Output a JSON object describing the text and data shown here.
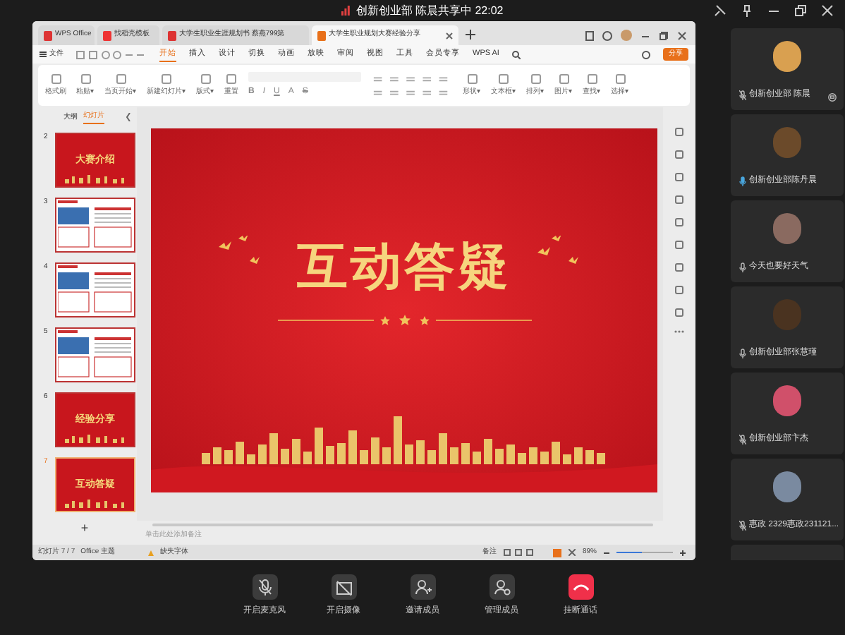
{
  "top_bar": {
    "title": "创新创业部 陈晨共享中 22:02"
  },
  "wps": {
    "tabs": [
      {
        "label": "WPS Office",
        "selected": false,
        "kind": "home"
      },
      {
        "label": "找稻壳模板",
        "selected": false,
        "kind": "template"
      },
      {
        "label": "大学生职业生涯规划书 蔡燕799第",
        "selected": false,
        "kind": "doc"
      },
      {
        "label": "大学生职业规划大赛经验分享",
        "selected": true,
        "kind": "doc"
      }
    ],
    "menu": {
      "file": "文件",
      "items": [
        {
          "label": "开始",
          "selected": true
        },
        {
          "label": "插入",
          "selected": false
        },
        {
          "label": "设计",
          "selected": false
        },
        {
          "label": "切换",
          "selected": false
        },
        {
          "label": "动画",
          "selected": false
        },
        {
          "label": "放映",
          "selected": false
        },
        {
          "label": "审阅",
          "selected": false
        },
        {
          "label": "视图",
          "selected": false
        },
        {
          "label": "工具",
          "selected": false
        },
        {
          "label": "会员专享",
          "selected": false
        },
        {
          "label": "WPS AI",
          "selected": false
        }
      ],
      "share": "分享"
    },
    "ribbon": {
      "left": [
        "格式刷",
        "粘贴▾",
        "当页开始▾",
        "新建幻灯片▾",
        "版式▾",
        "重置"
      ],
      "font_buttons": [
        "B",
        "I",
        "U",
        "A",
        "S"
      ],
      "right": [
        "形状▾",
        "文本框▾",
        "排列▾",
        "图片▾",
        "查找▾",
        "选择▾"
      ]
    },
    "panel_tabs": [
      {
        "label": "大纲",
        "selected": false
      },
      {
        "label": "幻灯片",
        "selected": true
      }
    ],
    "thumbnails": [
      {
        "number": "2",
        "kind": "title",
        "title": "大赛介绍",
        "selected": false
      },
      {
        "number": "3",
        "kind": "content",
        "selected": false
      },
      {
        "number": "4",
        "kind": "content",
        "selected": false
      },
      {
        "number": "5",
        "kind": "content",
        "selected": false
      },
      {
        "number": "6",
        "kind": "title",
        "title": "经验分享",
        "selected": false
      },
      {
        "number": "7",
        "kind": "title",
        "title": "互动答疑",
        "selected": true
      }
    ],
    "add_slide": "+",
    "slide": {
      "title": "互动答疑"
    },
    "notes_placeholder": "单击此处添加备注",
    "status": {
      "slide_count": "幻灯片 7 / 7",
      "theme": "Office 主题",
      "missing_font": "缺失字体",
      "notes": "备注",
      "zoom": "89%",
      "zoom_slider": {
        "level": 0.45
      }
    }
  },
  "participants": [
    {
      "name": "创新创业部 陈晨",
      "muted": true,
      "speaking": false,
      "sharing": true
    },
    {
      "name": "创新创业部陈丹晨",
      "muted": false,
      "speaking": true,
      "sharing": false
    },
    {
      "name": "今天也要好天气",
      "muted": false,
      "speaking": false,
      "sharing": false
    },
    {
      "name": "创新创业部张慧瑾",
      "muted": false,
      "speaking": false,
      "sharing": false
    },
    {
      "name": "创新创业部卞杰",
      "muted": true,
      "speaking": false,
      "sharing": false
    },
    {
      "name": "惠政 2329惠政231121...",
      "muted": true,
      "speaking": false,
      "sharing": false
    }
  ],
  "controls": [
    {
      "label": "开启麦克风",
      "kind": "mic"
    },
    {
      "label": "开启摄像",
      "kind": "camera"
    },
    {
      "label": "邀请成员",
      "kind": "invite"
    },
    {
      "label": "管理成员",
      "kind": "manage"
    },
    {
      "label": "挂断通话",
      "kind": "hangup"
    }
  ]
}
